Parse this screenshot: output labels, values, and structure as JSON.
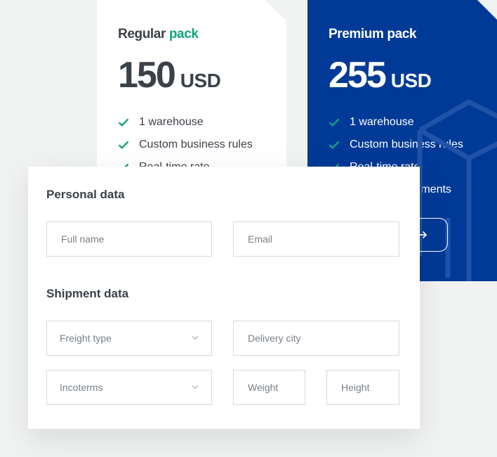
{
  "regular": {
    "title_main": "Regular",
    "title_accent": "pack",
    "price": "150",
    "currency": "USD",
    "features": [
      "1 warehouse",
      "Custom business rules",
      "Real-time rate"
    ]
  },
  "premium": {
    "title": "Premium pack",
    "price": "255",
    "currency": "USD",
    "features": [
      "1 warehouse",
      "Custom business rules",
      "Real-time rate",
      "hipments"
    ],
    "button_icon": "arrow-right-icon"
  },
  "form": {
    "personal_title": "Personal data",
    "full_name_placeholder": "Full name",
    "email_placeholder": "Email",
    "shipment_title": "Shipment data",
    "freight_placeholder": "Freight type",
    "delivery_city_placeholder": "Delivery city",
    "incoterms_placeholder": "Incoterms",
    "weight_placeholder": "Weight",
    "height_placeholder": "Height"
  },
  "colors": {
    "accent_green": "#14a37f",
    "premium_blue": "#003a96",
    "background": "#f1f3f2"
  }
}
